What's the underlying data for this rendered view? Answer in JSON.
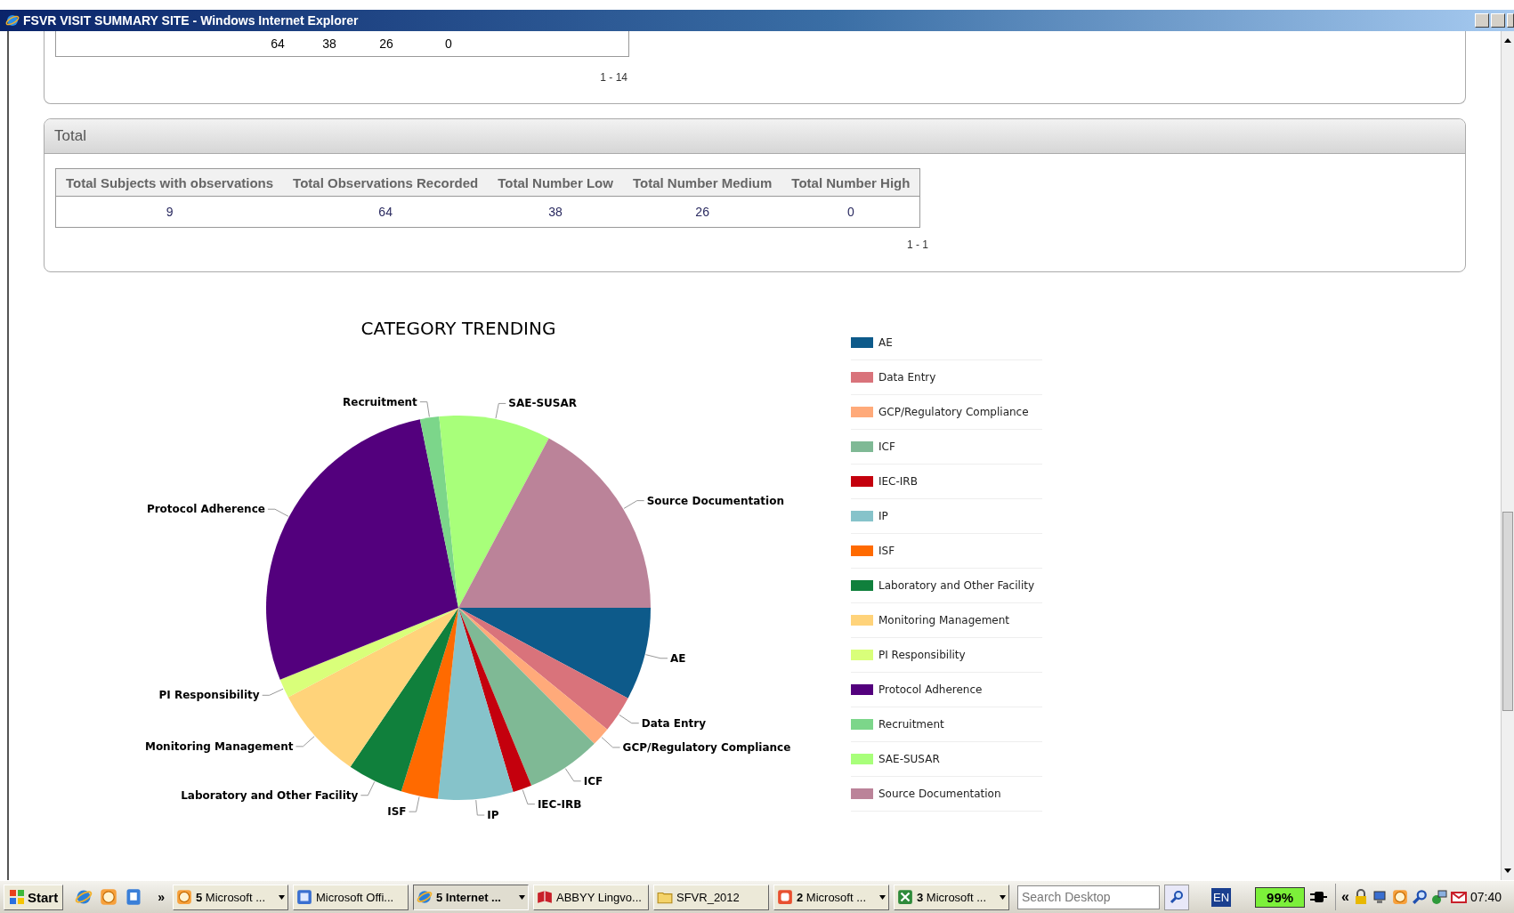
{
  "window": {
    "title": "FSVR VISIT SUMMARY SITE - Windows Internet Explorer"
  },
  "previous_panel": {
    "last_row": [
      "64",
      "38",
      "26",
      "0"
    ],
    "pager": "1 - 14"
  },
  "total_panel": {
    "title": "Total",
    "columns": [
      "Total Subjects with observations",
      "Total Observations Recorded",
      "Total Number Low",
      "Total Number Medium",
      "Total Number High"
    ],
    "rows": [
      [
        "9",
        "64",
        "38",
        "26",
        "0"
      ]
    ],
    "pager": "1 - 1"
  },
  "chart": {
    "chart_data": {
      "type": "pie",
      "title": "CATEGORY TRENDING",
      "categories": [
        "AE",
        "Data Entry",
        "GCP/Regulatory Compliance",
        "ICF",
        "IEC-IRB",
        "IP",
        "ISF",
        "Laboratory and Other Facility",
        "Monitoring Management",
        "PI Responsibility",
        "Protocol Adherence",
        "Recruitment",
        "SAE-SUSAR",
        "Source Documentation"
      ],
      "values": [
        7.8,
        3.1,
        1.6,
        6.3,
        1.6,
        6.3,
        3.1,
        4.7,
        7.8,
        1.6,
        27.9,
        1.6,
        9.4,
        17.2
      ]
    },
    "legend": [
      {
        "label": "AE",
        "color": "#0d5a8a"
      },
      {
        "label": "Data Entry",
        "color": "#d9737b"
      },
      {
        "label": "GCP/Regulatory Compliance",
        "color": "#ffaa7a"
      },
      {
        "label": "ICF",
        "color": "#7fb995"
      },
      {
        "label": "IEC-IRB",
        "color": "#c4000d"
      },
      {
        "label": "IP",
        "color": "#86c3ca"
      },
      {
        "label": "ISF",
        "color": "#ff6a00"
      },
      {
        "label": "Laboratory and Other Facility",
        "color": "#10803c"
      },
      {
        "label": "Monitoring Management",
        "color": "#ffd37a"
      },
      {
        "label": "PI Responsibility",
        "color": "#d9ff7a"
      },
      {
        "label": "Protocol Adherence",
        "color": "#53007d"
      },
      {
        "label": "Recruitment",
        "color": "#7cd68a"
      },
      {
        "label": "SAE-SUSAR",
        "color": "#a8ff7a"
      },
      {
        "label": "Source Documentation",
        "color": "#bb8399"
      }
    ]
  },
  "taskbar": {
    "start": "Start",
    "more": "»",
    "tasks": [
      {
        "label": "**5** Microsoft ...",
        "kind": "mail",
        "menu": true,
        "selected": false
      },
      {
        "label": "Microsoft Offi...",
        "kind": "office",
        "menu": false,
        "selected": false
      },
      {
        "label": "**5** Internet ...",
        "kind": "browser",
        "menu": true,
        "selected": true
      },
      {
        "label": "ABBYY Lingvo...",
        "kind": "book",
        "menu": false,
        "selected": false
      },
      {
        "label": "SFVR_2012",
        "kind": "folder",
        "menu": false,
        "selected": false
      },
      {
        "label": "**2** Microsoft ...",
        "kind": "pdf",
        "menu": true,
        "selected": false
      },
      {
        "label": "**3** Microsoft ...",
        "kind": "sheet",
        "menu": true,
        "selected": false
      }
    ],
    "search": {
      "placeholder": "Search Desktop"
    },
    "language": "EN",
    "battery": "99%",
    "tray_toggle": "«",
    "clock": "07:40"
  }
}
